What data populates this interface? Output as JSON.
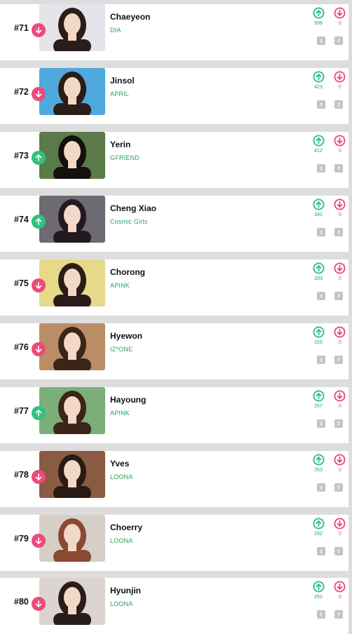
{
  "colors": {
    "down_accent": "#ec4a7d",
    "up_accent": "#2ec27e",
    "group_text": "#2aa05c",
    "separator": "#dddddd",
    "share_icon": "#c4c4c4"
  },
  "entries": [
    {
      "rank": "#71",
      "trend": "down",
      "name": "Chaeyeon",
      "group": "DIA",
      "votes_up": "506",
      "votes_down": "0",
      "photo_bg": "#e7e3ea",
      "hair": "#2a1d1a"
    },
    {
      "rank": "#72",
      "trend": "down",
      "name": "Jinsol",
      "group": "APRIL",
      "votes_up": "423",
      "votes_down": "0",
      "photo_bg": "#4fa9dd",
      "hair": "#2b1c17"
    },
    {
      "rank": "#73",
      "trend": "up",
      "name": "Yerin",
      "group": "GFRIEND",
      "votes_up": "412",
      "votes_down": "0",
      "photo_bg": "#5b7a4a",
      "hair": "#14100f"
    },
    {
      "rank": "#74",
      "trend": "up",
      "name": "Cheng Xiao",
      "group": "Cosmic Girls",
      "votes_up": "340",
      "votes_down": "0",
      "photo_bg": "#6d6a72",
      "hair": "#231a1f"
    },
    {
      "rank": "#75",
      "trend": "down",
      "name": "Chorong",
      "group": "APINK",
      "votes_up": "333",
      "votes_down": "0",
      "photo_bg": "#e6d98a",
      "hair": "#2a1c18"
    },
    {
      "rank": "#76",
      "trend": "down",
      "name": "Hyewon",
      "group": "IZ*ONE",
      "votes_up": "315",
      "votes_down": "0",
      "photo_bg": "#b98d66",
      "hair": "#3a2519"
    },
    {
      "rank": "#77",
      "trend": "up",
      "name": "Hayoung",
      "group": "APINK",
      "votes_up": "257",
      "votes_down": "0",
      "photo_bg": "#7cae7a",
      "hair": "#3b241a"
    },
    {
      "rank": "#78",
      "trend": "down",
      "name": "Yves",
      "group": "LOONA",
      "votes_up": "253",
      "votes_down": "0",
      "photo_bg": "#8a5b43",
      "hair": "#2a1a14"
    },
    {
      "rank": "#79",
      "trend": "down",
      "name": "Choerry",
      "group": "LOONA",
      "votes_up": "252",
      "votes_down": "0",
      "photo_bg": "#d6cfc8",
      "hair": "#8a4a32"
    },
    {
      "rank": "#80",
      "trend": "down",
      "name": "Hyunjin",
      "group": "LOONA",
      "votes_up": "252",
      "votes_down": "0",
      "photo_bg": "#dcd4d0",
      "hair": "#2a1c18"
    }
  ],
  "icons": {
    "trend_down": "arrow-down-icon",
    "trend_up": "arrow-up-icon",
    "vote_up": "vote-up-circle-icon",
    "vote_down": "vote-down-circle-icon",
    "share_twitter": "twitter-icon",
    "share_facebook": "facebook-icon"
  }
}
